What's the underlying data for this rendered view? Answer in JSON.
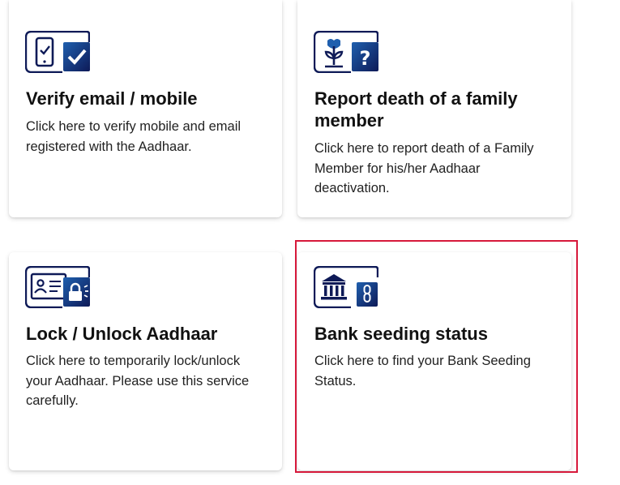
{
  "colors": {
    "icon_navy": "#0e1a57",
    "icon_blue": "#1f5fae",
    "highlight": "#d7193b"
  },
  "cards": [
    {
      "title": "Verify email / mobile",
      "description": "Click here to verify mobile and email registered with the Aadhaar.",
      "icon": "phone-checkmark-icon"
    },
    {
      "title": "Report death of a family member",
      "description": "Click here to report death of a Family Member for his/her Aadhaar deactivation.",
      "icon": "flower-question-icon"
    },
    {
      "title": "Lock / Unlock Aadhaar",
      "description": "Click here to temporarily lock/unlock your Aadhaar. Please use this service carefully.",
      "icon": "id-card-lock-icon"
    },
    {
      "title": "Bank seeding status",
      "description": "Click here to find your Bank Seeding Status.",
      "icon": "bank-link-icon"
    }
  ]
}
